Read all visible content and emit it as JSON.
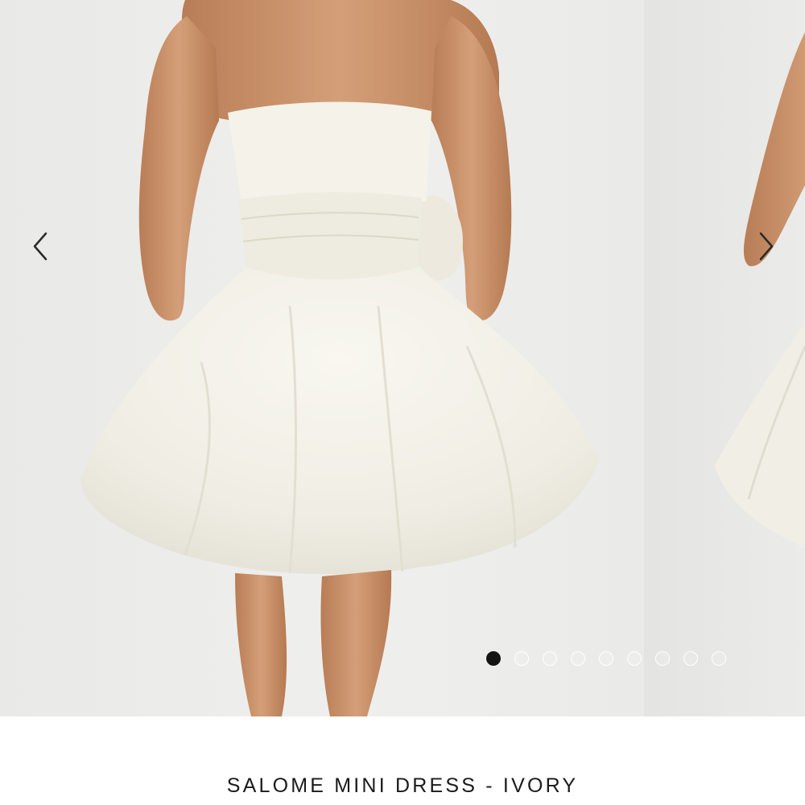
{
  "gallery": {
    "prev_icon": "chevron-left-icon",
    "next_icon": "chevron-right-icon",
    "image_count": 9,
    "active_index": 0,
    "dot_color_active": "#141414",
    "dot_color_inactive": "#ffffff"
  },
  "product": {
    "title": "SALOME MINI DRESS - IVORY",
    "dress_color": "#f3f1e7"
  }
}
